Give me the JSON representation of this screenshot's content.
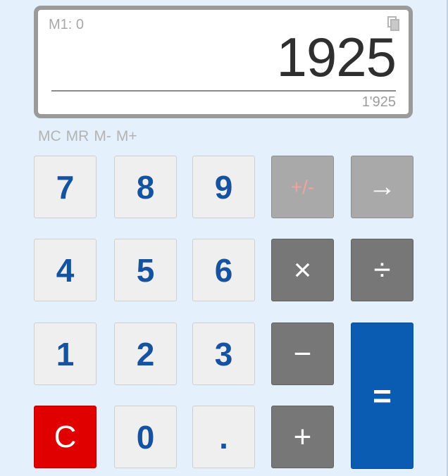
{
  "display": {
    "memory_indicator": "M1: 0",
    "main_value": "1925",
    "sub_value": "1'925"
  },
  "memory": {
    "mc": "MC",
    "mr": "MR",
    "m_minus": "M-",
    "m_plus": "M+"
  },
  "keys": {
    "k7": "7",
    "k8": "8",
    "k9": "9",
    "k4": "4",
    "k5": "5",
    "k6": "6",
    "k1": "1",
    "k2": "2",
    "k3": "3",
    "k0": "0",
    "dot": ".",
    "clear": "C",
    "negate": "+/-",
    "backspace": "→",
    "multiply": "×",
    "divide": "÷",
    "minus": "−",
    "plus": "+",
    "equals": "="
  },
  "colors": {
    "background": "#e4f1fc",
    "digit_text": "#1553a0",
    "operator": "#777777",
    "clear": "#e00000",
    "equals": "#0a5cb3"
  }
}
